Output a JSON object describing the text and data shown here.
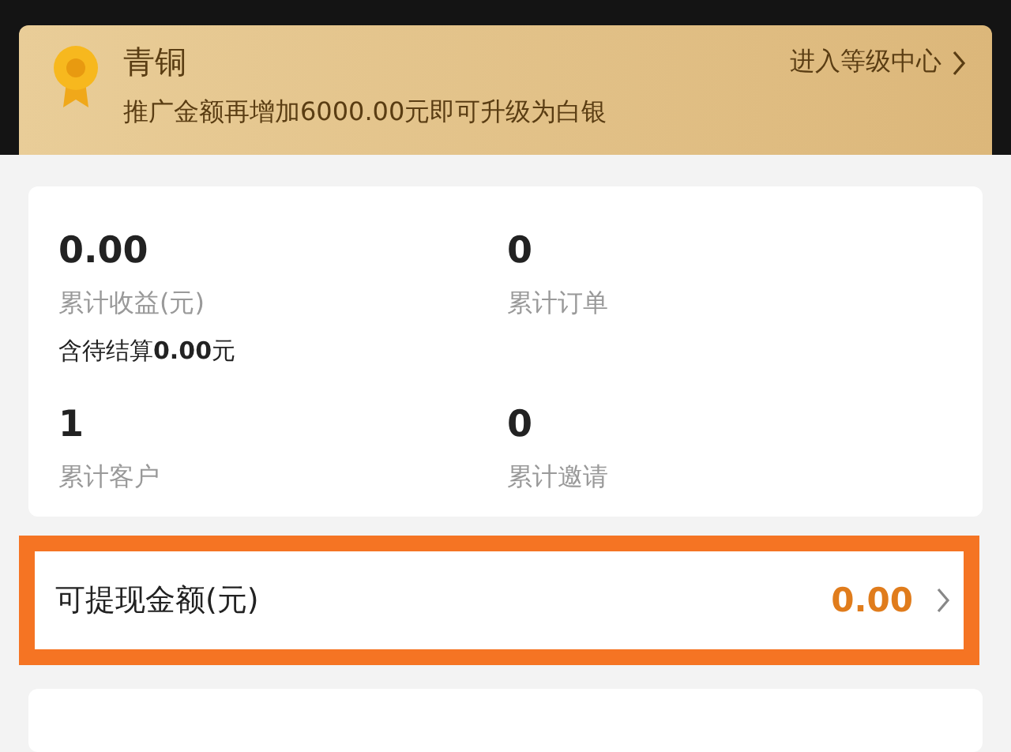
{
  "level_banner": {
    "level_name": "青铜",
    "link": "进入等级中心",
    "message": "推广金额再增加6000.00元即可升级为白银"
  },
  "stats": [
    {
      "value": "0.00",
      "label": "累计收益(元)",
      "note": "含待结算**0.00**元"
    },
    {
      "value": "0",
      "label": "累计订单"
    },
    {
      "value": "1",
      "label": "累计客户"
    },
    {
      "value": "0",
      "label": "累计邀请"
    }
  ],
  "withdraw": {
    "label": "可提现金额(元)",
    "amount": "0.00",
    "highlighted": true
  }
}
